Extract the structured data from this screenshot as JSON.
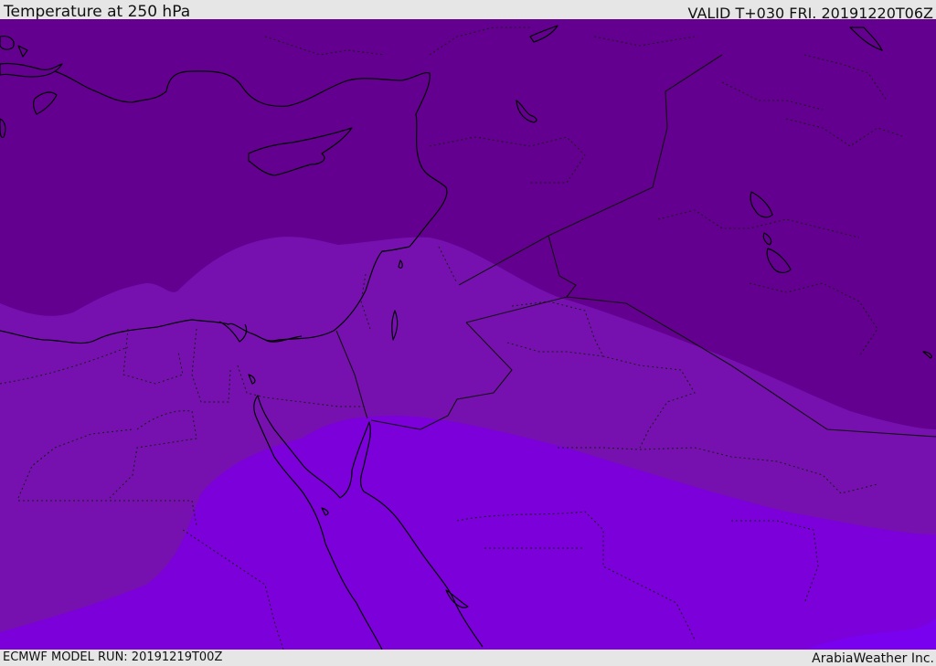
{
  "header": {
    "title": "Temperature at 250 hPa",
    "valid": "VALID T+030 FRI. 20191220T06Z"
  },
  "footer": {
    "model_run": "ECMWF MODEL RUN: 20191219T00Z",
    "credit": "ArabiaWeather Inc."
  },
  "map": {
    "colors": {
      "band_cold": "#64008f",
      "band_mid": "#7611b0",
      "band_warm": "#7b00d9",
      "band_warmest": "#7a00f0",
      "coastline": "#000000",
      "border": "#111111"
    }
  }
}
